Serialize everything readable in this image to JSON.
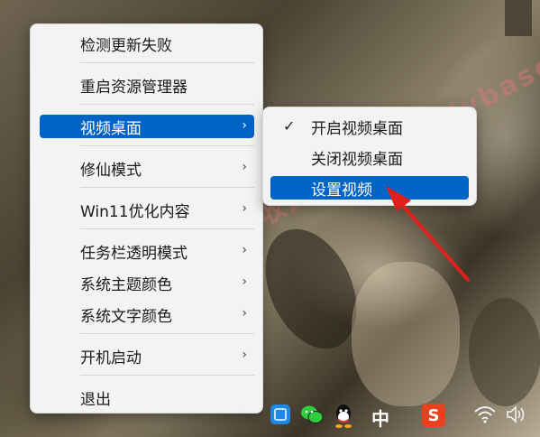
{
  "menu": {
    "items": [
      {
        "label": "检测更新失败",
        "submenu": false
      },
      {
        "label": "重启资源管理器",
        "submenu": false
      },
      {
        "label": "视频桌面",
        "submenu": true,
        "active": true
      },
      {
        "label": "修仙模式",
        "submenu": true
      },
      {
        "label": "Win11优化内容",
        "submenu": true
      },
      {
        "label": "任务栏透明模式",
        "submenu": true
      },
      {
        "label": "系统主题颜色",
        "submenu": true
      },
      {
        "label": "系统文字颜色",
        "submenu": true
      },
      {
        "label": "开机启动",
        "submenu": true
      },
      {
        "label": "退出",
        "submenu": false
      }
    ],
    "submenu_arrow": "›"
  },
  "submenu": {
    "items": [
      {
        "label": "开启视频桌面",
        "checked": true
      },
      {
        "label": "关闭视频桌面",
        "checked": false
      },
      {
        "label": "设置视频",
        "checked": false,
        "active": true
      }
    ],
    "check_glyph": "✓"
  },
  "watermark": "记得收藏:黑域基地 Hybase.com",
  "tray": {
    "chevron": "^",
    "ime_label": "中",
    "sogou_label": "S",
    "icons": [
      "tray-app-icon",
      "wechat-icon",
      "qq-icon",
      "ime-icon",
      "sogou-icon",
      "wifi-icon",
      "volume-icon"
    ]
  },
  "colors": {
    "accent": "#0063c6",
    "menu_bg": "#f3f3f3",
    "annotation_arrow": "#e0201c"
  }
}
